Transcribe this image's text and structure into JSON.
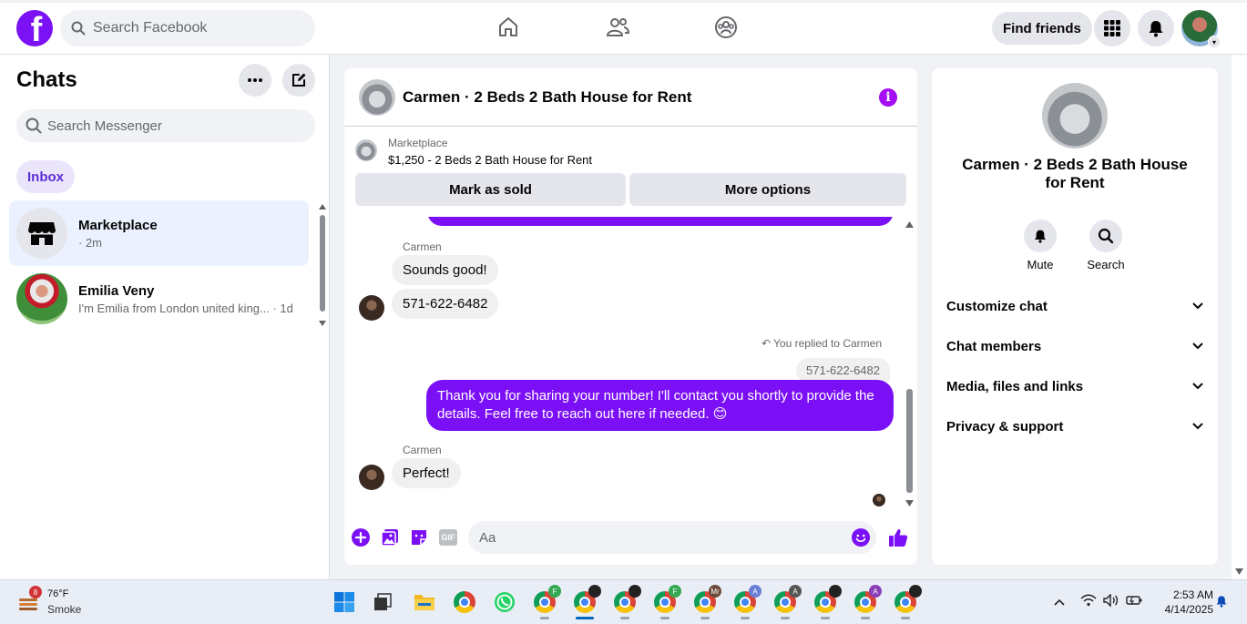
{
  "topbar": {
    "logo_letter": "f",
    "search_placeholder": "Search Facebook",
    "find_friends": "Find friends",
    "nav_icons": [
      "home-icon",
      "friends-icon",
      "groups-icon"
    ],
    "right_icons": [
      "menu-grid-icon",
      "notifications-bell-icon",
      "account-avatar"
    ]
  },
  "sidebar": {
    "title": "Chats",
    "search_placeholder": "Search Messenger",
    "filter_tab": "Inbox",
    "chats": [
      {
        "name": "Marketplace",
        "subtitle": "· 2m",
        "active": true
      },
      {
        "name": "Emilia Veny",
        "subtitle": "I'm Emilia from London united king... · 1d",
        "active": false
      }
    ]
  },
  "conversation": {
    "title": "Carmen · 2 Beds 2 Bath House for Rent",
    "marketplace_label": "Marketplace",
    "listing": "$1,250 - 2 Beds 2 Bath House for Rent",
    "mark_sold": "Mark as sold",
    "more_options": "More options",
    "messages": [
      {
        "sender": "Carmen",
        "text": "Sounds good!"
      },
      {
        "text": "571-622-6482"
      },
      {
        "reply_label": "You replied to Carmen",
        "quoted": "571-622-6482"
      },
      {
        "outgoing": "Thank you for sharing your number! I'll contact you shortly to provide the details. Feel free to reach out here if needed. 😊"
      },
      {
        "sender": "Carmen",
        "text": "Perfect!"
      }
    ],
    "composer_placeholder": "Aa",
    "gif_label": "GIF"
  },
  "info_panel": {
    "name": "Carmen · 2 Beds 2 Bath House for Rent",
    "mute": "Mute",
    "search": "Search",
    "sections": [
      "Customize chat",
      "Chat members",
      "Media, files and links",
      "Privacy & support"
    ]
  },
  "taskbar": {
    "weather_badge": "8",
    "temp": "76°F",
    "condition": "Smoke",
    "badges": [
      "F",
      "Mr",
      "A",
      "A",
      "A"
    ],
    "time": "2:53 AM",
    "date": "4/14/2025"
  },
  "colors": {
    "accent": "#7b10f7",
    "fb_logo": "#7b11f5",
    "inbox_tab_bg": "#ebe5fc",
    "inbox_tab_text": "#5b2fd6",
    "info_icon": "#a40ff5"
  }
}
